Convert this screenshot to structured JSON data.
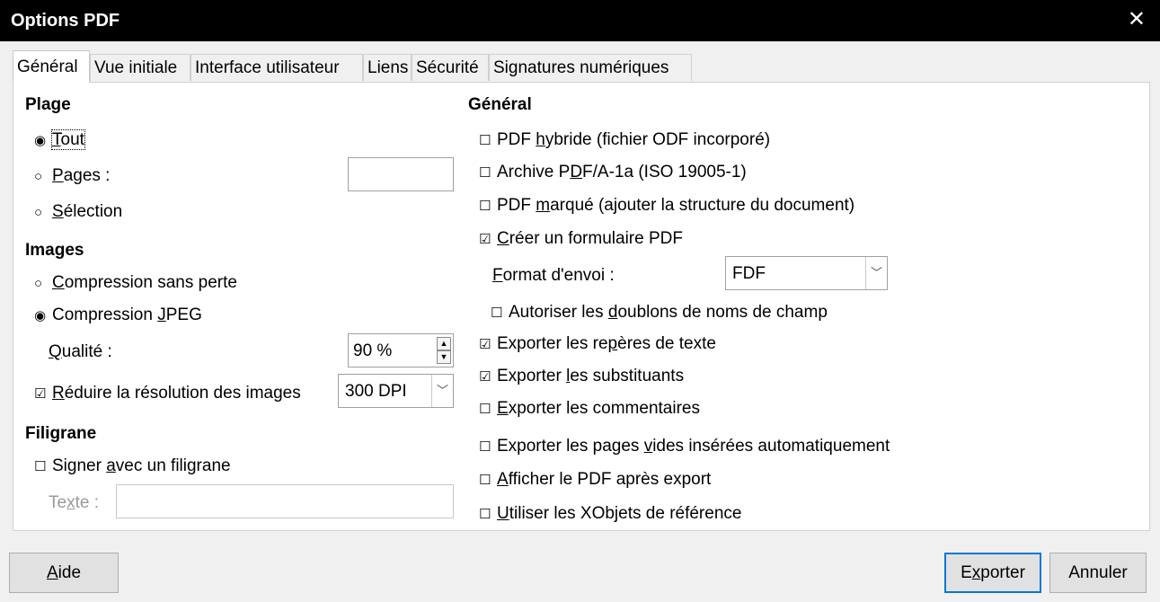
{
  "window": {
    "title": "Options PDF",
    "close_glyph": "✕"
  },
  "tabs": [
    "Général",
    "Vue initiale",
    "Interface utilisateur",
    "Liens",
    "Sécurité",
    "Signatures numériques"
  ],
  "range": {
    "heading": "Plage",
    "all": {
      "pre": "",
      "ul": "T",
      "post": "out",
      "checked": true
    },
    "pages": {
      "pre": "",
      "ul": "P",
      "post": "ages :",
      "checked": false,
      "value": ""
    },
    "selection": {
      "pre": "",
      "ul": "S",
      "post": "élection",
      "checked": false
    }
  },
  "images": {
    "heading": "Images",
    "lossless": {
      "pre": "",
      "ul": "C",
      "post": "ompression sans perte",
      "checked": false
    },
    "jpeg": {
      "pre": "Compression ",
      "ul": "J",
      "post": "PEG",
      "checked": true
    },
    "quality": {
      "pre": "",
      "ul": "Q",
      "post": "ualité :",
      "value": "90 %"
    },
    "reduce": {
      "pre": "",
      "ul": "R",
      "post": "éduire la résolution des images",
      "checked": true,
      "value": "300 DPI"
    }
  },
  "watermark": {
    "heading": "Filigrane",
    "sign": {
      "pre": "Signer ",
      "ul": "a",
      "post": "vec un filigrane",
      "checked": false
    },
    "text": {
      "pre": "Te",
      "ul": "x",
      "post": "te :",
      "value": ""
    }
  },
  "general": {
    "heading": "Général",
    "hybrid": {
      "pre": "PDF ",
      "ul": "h",
      "post": "ybride (fichier ODF incorporé)",
      "checked": false
    },
    "archive": {
      "pre": "Archive P",
      "ul": "D",
      "post": "F/A-1a (ISO 19005-1)",
      "checked": false
    },
    "tagged": {
      "pre": "PDF ",
      "ul": "m",
      "post": "arqué (ajouter la structure du document)",
      "checked": false
    },
    "form": {
      "pre": "",
      "ul": "C",
      "post": "réer un formulaire PDF",
      "checked": true
    },
    "submit_format": {
      "pre": "",
      "ul": "F",
      "post": "ormat d'envoi :",
      "value": "FDF"
    },
    "duplicates": {
      "pre": "Autoriser les ",
      "ul": "d",
      "post": "oublons de noms de champ",
      "checked": false
    },
    "bookmarks": {
      "pre": "Exporter les re",
      "ul": "p",
      "post": "ères de texte",
      "checked": true
    },
    "placeholders": {
      "pre": "Exporter ",
      "ul": "l",
      "post": "es substituants",
      "checked": true
    },
    "comments": {
      "pre": "",
      "ul": "E",
      "post": "xporter les commentaires",
      "checked": false
    },
    "blank_pages": {
      "pre": "Exporter les pages ",
      "ul": "v",
      "post": "ides insérées automatiquement",
      "checked": false
    },
    "view_after": {
      "pre": "",
      "ul": "A",
      "post": "fficher le PDF après export",
      "checked": false
    },
    "xobjects": {
      "pre": "",
      "ul": "U",
      "post": "tiliser les XObjets de référence",
      "checked": false
    }
  },
  "buttons": {
    "help": {
      "pre": "",
      "ul": "A",
      "post": "ide"
    },
    "export": {
      "pre": "E",
      "ul": "x",
      "post": "porter"
    },
    "cancel": {
      "pre": "",
      "ul": "",
      "post": "Annuler"
    }
  },
  "glyphs": {
    "radio_on": "◉",
    "radio_off": "○",
    "check_on": "☑",
    "check_off": "☐",
    "combo_arrow": "﹀",
    "spin_up": "▲",
    "spin_down": "▼"
  }
}
